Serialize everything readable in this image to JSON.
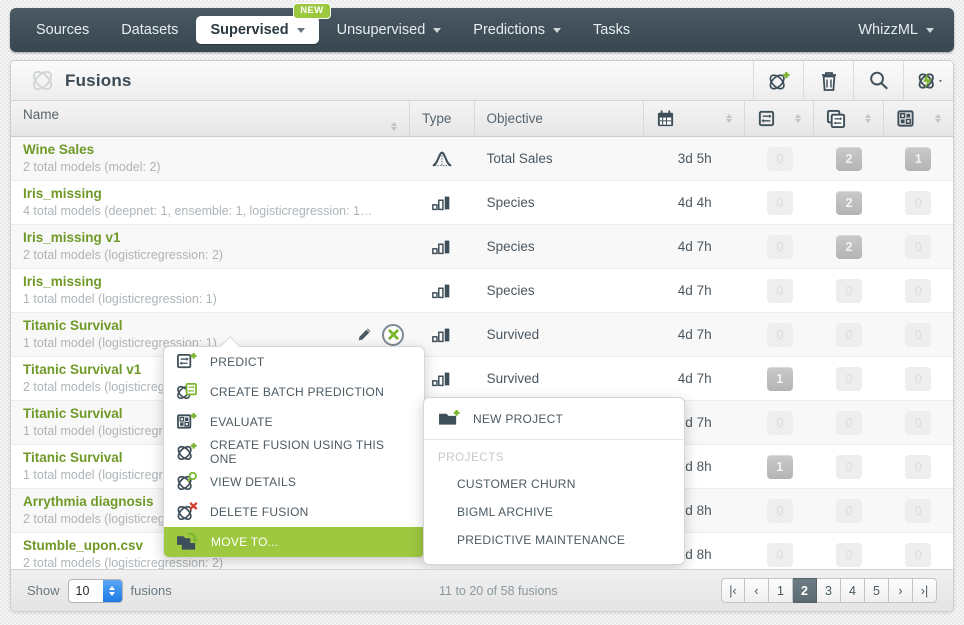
{
  "nav": {
    "items": [
      {
        "label": "Sources",
        "caret": false,
        "active": false,
        "badge": null
      },
      {
        "label": "Datasets",
        "caret": false,
        "active": false,
        "badge": null
      },
      {
        "label": "Supervised",
        "caret": true,
        "active": true,
        "badge": "NEW"
      },
      {
        "label": "Unsupervised",
        "caret": true,
        "active": false,
        "badge": null
      },
      {
        "label": "Predictions",
        "caret": true,
        "active": false,
        "badge": null
      },
      {
        "label": "Tasks",
        "caret": false,
        "active": false,
        "badge": null
      }
    ],
    "right": {
      "label": "WhizzML",
      "caret": true
    }
  },
  "header": {
    "title": "Fusions",
    "logo_icon": "fusion-atom-icon",
    "actions": [
      {
        "name": "create-fusion-icon",
        "icon": "fusion-plus-icon"
      },
      {
        "name": "delete-icon",
        "icon": "trash-icon"
      },
      {
        "name": "search-icon",
        "icon": "magnifier-icon"
      },
      {
        "name": "whizzml-script-icon",
        "icon": "lightning-atom-icon"
      }
    ]
  },
  "table": {
    "columns": [
      {
        "label": "Name",
        "icon": null,
        "sortable": true
      },
      {
        "label": "Type",
        "icon": null,
        "sortable": false
      },
      {
        "label": "Objective",
        "icon": null,
        "sortable": false
      },
      {
        "label": "",
        "icon": "calendar-icon",
        "sortable": true
      },
      {
        "label": "",
        "icon": "prediction-icon",
        "sortable": true
      },
      {
        "label": "",
        "icon": "batch-prediction-icon",
        "sortable": true
      },
      {
        "label": "",
        "icon": "evaluation-icon",
        "sortable": true
      }
    ],
    "rows": [
      {
        "name": "Wine Sales",
        "sub": "2 total models (model: 2)",
        "type_icon": "regression-icon",
        "objective": "Total Sales",
        "date": "3d 5h",
        "predictions": "0",
        "batch_predictions": "2",
        "evaluations": "1"
      },
      {
        "name": "Iris_missing",
        "sub": "4 total models (deepnet: 1, ensemble: 1, logisticregression: 1…",
        "type_icon": "classification-icon",
        "objective": "Species",
        "date": "4d 4h",
        "predictions": "0",
        "batch_predictions": "2",
        "evaluations": "0"
      },
      {
        "name": "Iris_missing v1",
        "sub": "2 total models (logisticregression: 2)",
        "type_icon": "classification-icon",
        "objective": "Species",
        "date": "4d 7h",
        "predictions": "0",
        "batch_predictions": "2",
        "evaluations": "0"
      },
      {
        "name": "Iris_missing",
        "sub": "1 total model (logisticregression: 1)",
        "type_icon": "classification-icon",
        "objective": "Species",
        "date": "4d 7h",
        "predictions": "0",
        "batch_predictions": "0",
        "evaluations": "0"
      },
      {
        "name": "Titanic Survival",
        "sub": "1 total model (logisticregression: 1)",
        "type_icon": "classification-icon",
        "objective": "Survived",
        "date": "4d 7h",
        "predictions": "0",
        "batch_predictions": "0",
        "evaluations": "0",
        "hovered": true
      },
      {
        "name": "Titanic Survival v1",
        "sub": "2 total models (logisticregression: 2)",
        "type_icon": "classification-icon",
        "objective": "Survived",
        "date": "4d 7h",
        "predictions": "1",
        "batch_predictions": "0",
        "evaluations": "0"
      },
      {
        "name": "Titanic Survival",
        "sub": "1 total model (logisticregression: 1)",
        "type_icon": "classification-icon",
        "objective": "",
        "date": "4d 7h",
        "predictions": "0",
        "batch_predictions": "0",
        "evaluations": "0"
      },
      {
        "name": "Titanic Survival",
        "sub": "1 total model (logisticregression: 1)",
        "type_icon": "classification-icon",
        "objective": "",
        "date": "4d 8h",
        "predictions": "1",
        "batch_predictions": "0",
        "evaluations": "0"
      },
      {
        "name": "Arrythmia diagnosis",
        "sub": "2 total models (logisticregression: 2)",
        "type_icon": "classification-icon",
        "objective": "",
        "date": "4d 8h",
        "predictions": "0",
        "batch_predictions": "0",
        "evaluations": "0"
      },
      {
        "name": "Stumble_upon.csv",
        "sub": "2 total models (logisticregression: 2)",
        "type_icon": "classification-icon",
        "objective": "",
        "date": "4d 8h",
        "predictions": "0",
        "batch_predictions": "0",
        "evaluations": "0"
      }
    ]
  },
  "context_menu": {
    "items": [
      {
        "label": "PREDICT",
        "icon": "predict-icon",
        "selected": false
      },
      {
        "label": "CREATE BATCH PREDICTION",
        "icon": "batch-prediction-icon",
        "selected": false
      },
      {
        "label": "EVALUATE",
        "icon": "evaluate-icon",
        "selected": false
      },
      {
        "label": "CREATE FUSION USING THIS ONE",
        "icon": "create-fusion-icon",
        "selected": false
      },
      {
        "label": "VIEW DETAILS",
        "icon": "view-details-icon",
        "selected": false
      },
      {
        "label": "DELETE FUSION",
        "icon": "delete-fusion-icon",
        "selected": false
      },
      {
        "label": "MOVE TO...",
        "icon": "move-to-folder-icon",
        "selected": true
      }
    ]
  },
  "submenu": {
    "new_project": {
      "label": "NEW PROJECT",
      "icon": "new-folder-icon"
    },
    "group_label": "PROJECTS",
    "projects": [
      {
        "label": "CUSTOMER CHURN"
      },
      {
        "label": "BIGML ARCHIVE"
      },
      {
        "label": "PREDICTIVE MAINTENANCE"
      }
    ]
  },
  "footer": {
    "show_label": "Show",
    "page_size": "10",
    "unit_label": "fusions",
    "range_text": "11 to 20 of 58 fusions",
    "pages": [
      "1",
      "2",
      "3",
      "4",
      "5"
    ],
    "current_page": "2",
    "first_label": "|‹",
    "prev_label": "‹",
    "next_label": "›",
    "last_label": "›|"
  },
  "colors": {
    "nav_bg": "#41505a",
    "accent_green": "#9dc83f",
    "row_name_green": "#6f9a27",
    "badge_new": "#9bc83c",
    "text_dark": "#4b5760"
  }
}
